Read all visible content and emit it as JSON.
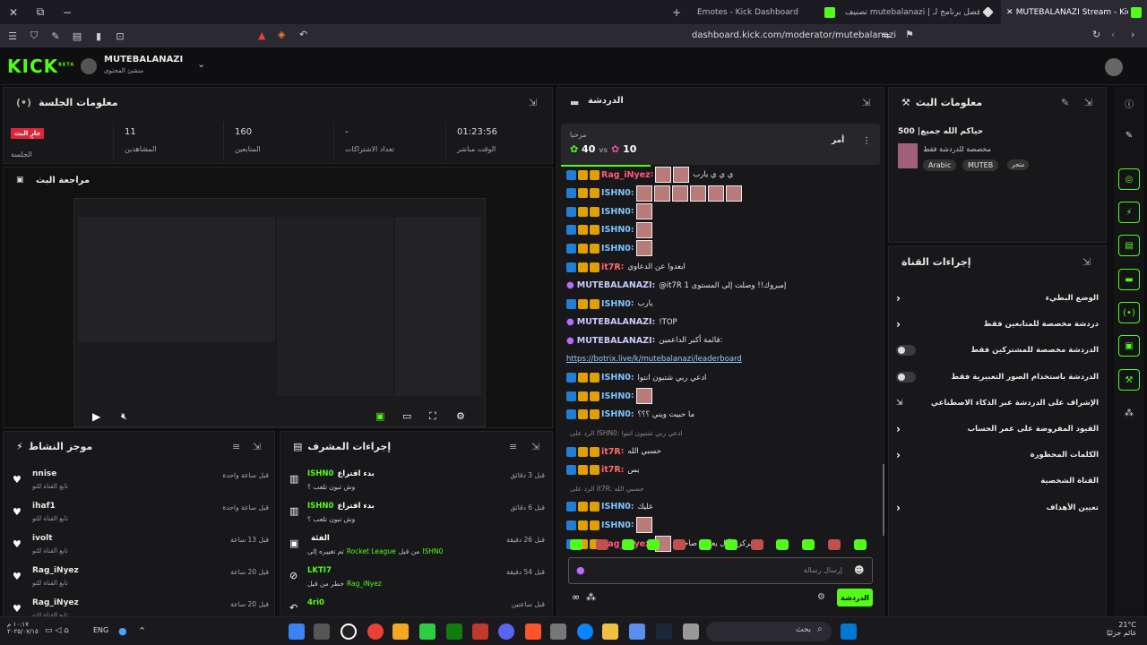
{
  "browser": {
    "tabs": [
      {
        "label": "Emotes - Kick Dashboard"
      },
      {
        "label": "تصنيف mutebalanazi | أفضل برنامج لـ"
      },
      {
        "label": "MUTEBALANAZI Stream - Kick D"
      }
    ],
    "new_tab": "+",
    "url": "dashboard.kick.com/moderator/mutebalanazi"
  },
  "header": {
    "logo": "KICK",
    "logo_beta": "BETA",
    "channel": "MUTEBALANAZI",
    "role": "منشئ المحتوى"
  },
  "session": {
    "title": "معلومات الجلسة",
    "live_badge": "جارٍ البث",
    "live_label": "الجلسة",
    "stats": [
      {
        "value": "11",
        "label": "المشاهدين"
      },
      {
        "value": "160",
        "label": "المتابعين"
      },
      {
        "value": "-",
        "label": "تعداد الاشتراكات"
      },
      {
        "value": "01:23:56",
        "label": "الوقت مباشر"
      }
    ]
  },
  "preview": {
    "title": "مراجعة البث"
  },
  "activity": {
    "title": "موجز النشاط",
    "items": [
      {
        "name": "nnise",
        "sub": "تابع القناة للتو",
        "time": "قبل ساعة واحدة"
      },
      {
        "name": "ihaf1",
        "sub": "تابع القناة للتو",
        "time": "قبل ساعة واحدة"
      },
      {
        "name": "ivolt",
        "sub": "تابع القناة للتو",
        "time": "قبل 13 ساعة"
      },
      {
        "name": "Rag_iNyez",
        "sub": "تابع القناة للتو",
        "time": "قبل 20 ساعة"
      },
      {
        "name": "Rag_iNyez",
        "sub": "تابع القناة للتو",
        "time": "قبل 20 ساعة"
      }
    ]
  },
  "modactions": {
    "title": "إجراءات المشرف",
    "items": [
      {
        "user": "ISHN0",
        "action": "بدء اقتراع",
        "sub": "وش تبون تلعب ؟",
        "time": "قبل 3 دقائق"
      },
      {
        "user": "ISHN0",
        "action": "بدء اقتراع",
        "sub": "وش تبون تلعب ؟",
        "time": "قبل 6 دقائق"
      },
      {
        "user": "",
        "action": "الفئة",
        "sub": "تم تغييره إلى",
        "sub_game": "Rocket League",
        "sub_by": "من قبل",
        "sub_user": "ISHN0",
        "time": "قبل 26 دقيقة"
      },
      {
        "user": "LKTI7",
        "action": "",
        "sub": "خطر من قبل",
        "sub_user": "Rag_iNyez",
        "time": "قبل 54 دقيقة"
      },
      {
        "user": "4ri0",
        "action": "",
        "sub": "",
        "time": "قبل ساعتين"
      }
    ]
  },
  "chat": {
    "title": "الدردشة",
    "greeting": "مرحبا",
    "score_left": "40",
    "vs": "vs",
    "score_right": "10",
    "older": "أمر",
    "lines": [
      {
        "user": "Rag_iNyez",
        "color": "#ff5a7a",
        "msg": "ي ي ي يارب"
      },
      {
        "user": "ISHN0",
        "color": "#7ec4ff",
        "msg": ""
      },
      {
        "user": "ISHN0",
        "color": "#7ec4ff",
        "msg": ""
      },
      {
        "user": "ISHN0",
        "color": "#7ec4ff",
        "msg": ""
      },
      {
        "user": "ISHN0",
        "color": "#7ec4ff",
        "msg": ""
      },
      {
        "user": "it7R",
        "color": "#ff6b6b",
        "msg": "ابعدوا عن الدعاوي"
      },
      {
        "user": "MUTEBALANAZI",
        "color": "#c9c9ff",
        "msg": "@it7R إمبروك!! وصلت إلى المستوى 1"
      },
      {
        "user": "ISHN0",
        "color": "#7ec4ff",
        "msg": "يارب"
      },
      {
        "user": "MUTEBALANAZI",
        "color": "#c9c9ff",
        "msg": "!TOP"
      },
      {
        "user": "MUTEBALANAZI",
        "color": "#c9c9ff",
        "msg": "قائمة أكبر الداعمين:"
      },
      {
        "user": "",
        "color": "#9ecbff",
        "msg": "https://botrix.live/k/mutebalanazi/leaderboard"
      },
      {
        "user": "ISHN0",
        "color": "#7ec4ff",
        "msg": "ادعي ربي شتبون انتوا"
      },
      {
        "user": "ISHN0",
        "color": "#7ec4ff",
        "msg": ""
      },
      {
        "user": "ISHN0",
        "color": "#7ec4ff",
        "msg": "ما حبيت ويني ؟؟؟"
      },
      {
        "user": "",
        "color": "#888",
        "msg": "الرد على ISHN0: ادعي ربي شتبون انتوا"
      },
      {
        "user": "it7R",
        "color": "#ff6b6b",
        "msg": "حسبي الله"
      },
      {
        "user": "it7R",
        "color": "#ff6b6b",
        "msg": "بس"
      },
      {
        "user": "",
        "color": "#888",
        "msg": "الرد على it7R: حسبي الله"
      },
      {
        "user": "ISHN0",
        "color": "#7ec4ff",
        "msg": "عليك"
      },
      {
        "user": "ISHN0",
        "color": "#7ec4ff",
        "msg": ""
      },
      {
        "user": "Rag_iNyez",
        "color": "#ff5a7a",
        "msg": "المركز الأول يعرف صاحبته"
      }
    ],
    "placeholder": "إرسال رسالة",
    "send": "الدردشة"
  },
  "streaminfo": {
    "title": "معلومات البث",
    "stream_title": "حياكم الله جميع| 500",
    "sub": "مخصصة للدردشة فقط",
    "tags": [
      "Arabic",
      "MUTEB",
      "متجر"
    ]
  },
  "channel_actions": {
    "title": "إجراءات القناة",
    "items": [
      {
        "label": "الوضع البطيء",
        "ctl": "arrow"
      },
      {
        "label": "دردشة مخصصة للمتابعين فقط",
        "ctl": "arrow"
      },
      {
        "label": "الدردشة مخصصة للمشتركين فقط",
        "ctl": "toggle"
      },
      {
        "label": "الدردشة باستخدام الصور التعبيرية فقط",
        "ctl": "toggle"
      },
      {
        "label": "الإشراف على الدردشة عبر الذكاء الاصطناعي",
        "ctl": "ext"
      },
      {
        "label": "القيود المفروضة على عمر الحساب",
        "ctl": "arrow"
      },
      {
        "label": "الكلمات المحظورة",
        "ctl": "arrow"
      },
      {
        "label": "القناة الشخصية",
        "ctl": "none"
      },
      {
        "label": "تعيين الأهداف",
        "ctl": "arrow"
      }
    ]
  },
  "taskbar": {
    "lang": "ENG",
    "time": "١٠:١٧ م",
    "date": "٢٠٢٥/٠٧/١٥",
    "search": "بحث",
    "weather_temp": "21°C",
    "weather_label": "غائم جزئيًا"
  }
}
